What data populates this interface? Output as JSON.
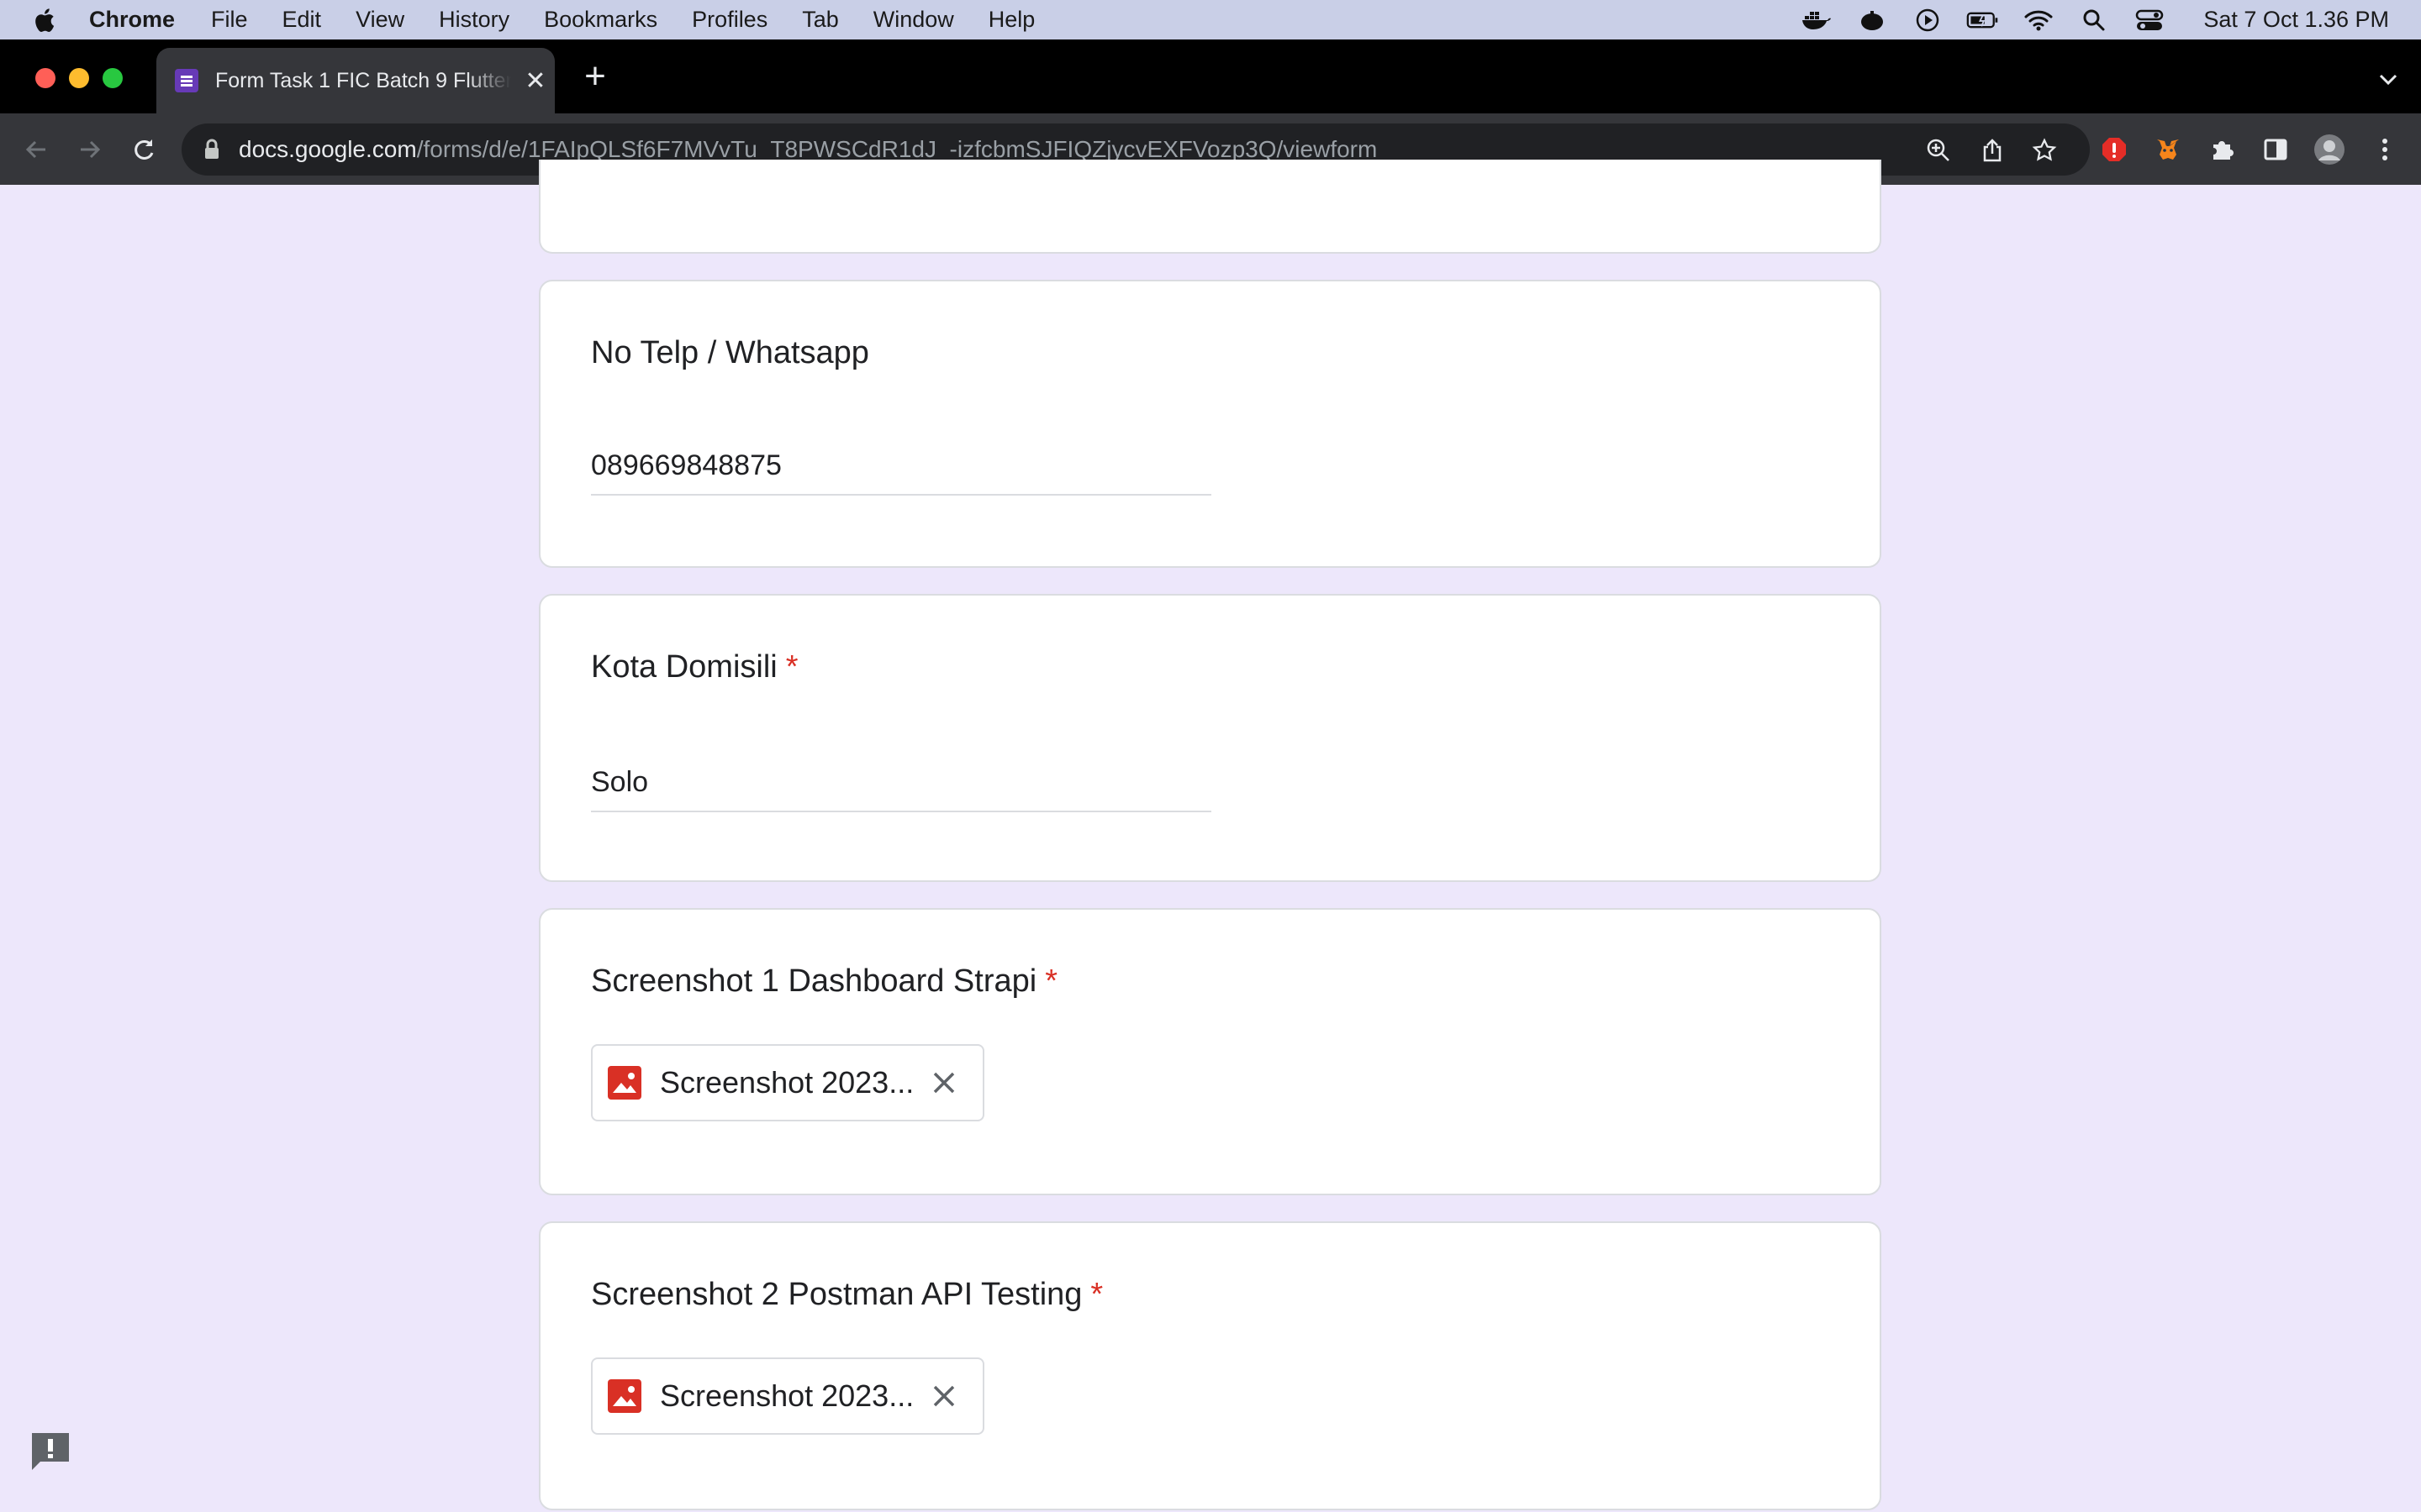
{
  "menubar": {
    "app_name": "Chrome",
    "menus": [
      "File",
      "Edit",
      "View",
      "History",
      "Bookmarks",
      "Profiles",
      "Tab",
      "Window",
      "Help"
    ],
    "clock": "Sat 7 Oct  1.36 PM",
    "status_icons": [
      "docker-icon",
      "cloud-icon",
      "play-circle-icon",
      "battery-icon",
      "wifi-icon",
      "spotlight-icon",
      "control-center-icon"
    ]
  },
  "tab": {
    "title": "Form Task 1 FIC Batch 9 Flutter",
    "favicon": "google-forms-icon"
  },
  "address_bar": {
    "host": "docs.google.com",
    "path": "/forms/d/e/1FAIpQLSf6F7MVvTu_T8PWSCdR1dJ_-izfcbmSJFIQZjycvEXFVozp3Q/viewform"
  },
  "form": {
    "questions": [
      {
        "label": "No Telp / Whatsapp",
        "required": false,
        "value": "089669848875"
      },
      {
        "label": "Kota Domisili",
        "required": true,
        "value": "Solo"
      },
      {
        "label": "Screenshot 1 Dashboard Strapi",
        "required": true,
        "file": "Screenshot 2023..."
      },
      {
        "label": "Screenshot 2 Postman API Testing",
        "required": true,
        "file": "Screenshot 2023..."
      }
    ],
    "required_marker": "*"
  },
  "colors": {
    "page_bg": "#ede7fb",
    "required": "#d93025",
    "forms_purple": "#673ab7",
    "image_icon": "#d93025"
  }
}
